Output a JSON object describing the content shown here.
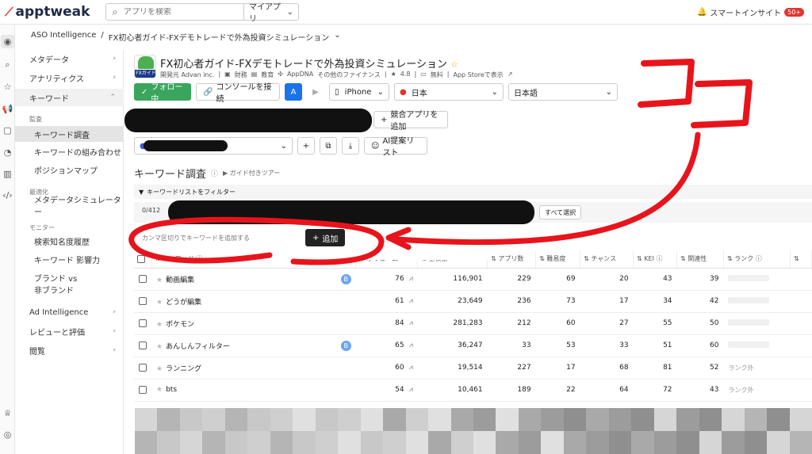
{
  "brand": {
    "name": "apptweak"
  },
  "topbar": {
    "search_placeholder": "アプリを検索",
    "my_apps_label": "マイアプリ",
    "insight_label": "スマートインサイト",
    "insight_badge": "50+"
  },
  "breadcrumb": {
    "root": "ASO Intelligence",
    "separator": "/",
    "current": "FX初心者ガイド-FXデモトレードで外為投資シミュレーション"
  },
  "sidebar": {
    "metadata": "メタデータ",
    "analytics": "アナリティクス",
    "keywords": "キーワード",
    "section_monitor": "監査",
    "keyword_research": "キーワード調査",
    "keyword_combinations": "キーワードの組み合わせ",
    "position_map": "ポジションマップ",
    "section_optimize": "最適化",
    "metadata_simulator": "メタデータシミュレーター",
    "section_monitoring": "モニター",
    "search_awareness_history": "検索知名度履歴",
    "keyword_impact": "キーワード 影響力",
    "brand_vs": "ブランド vs",
    "non_brand": "非ブランド",
    "ad_intelligence": "Ad Intelligence",
    "reviews": "レビューと評価",
    "browse": "閲覧"
  },
  "app": {
    "icon_label": "FXガイド",
    "title": "FX初心者ガイド-FXデモトレードで外為投資シミュレーション",
    "developer": "開発元 Advan inc.",
    "category1": "財務",
    "category2": "教育",
    "appdna": "AppDNA",
    "appdna_value": "その他のファイナンス",
    "rating": "4.8",
    "price": "無料",
    "store_link": "App Storeで表示"
  },
  "toolbar": {
    "follow": "フォロー中",
    "console": "コンソールを接続",
    "device": "iPhone",
    "country": "日本",
    "language": "日本語"
  },
  "competitors": {
    "add_label": "競合アプリを追加"
  },
  "list_bar": {
    "ai_suggest": "AI提案リスト"
  },
  "section": {
    "title": "キーワード調査",
    "guide": "ガイド付きツアー"
  },
  "filter": {
    "label": "キーワードリストをフィルター",
    "count": "0/412",
    "select_all": "すべて選択"
  },
  "add_keyword": {
    "placeholder": "カンマ区切りでキーワードを追加する",
    "button": "追加"
  },
  "table": {
    "headers": {
      "keyword": "キーワード",
      "volume": "ボリューム",
      "total_search": "全検索",
      "apps": "アプリ数",
      "difficulty": "難易度",
      "chance": "チャンス",
      "kei": "KEI",
      "relevance": "関連性",
      "rank": "ランク"
    },
    "rows": [
      {
        "keyword": "動画編集",
        "volume": "76",
        "total": "116,901",
        "apps": "229",
        "difficulty": "69",
        "chance": "20",
        "kei": "43",
        "relevance": "39",
        "rank": "",
        "brand": "B"
      },
      {
        "keyword": "どうが編集",
        "volume": "61",
        "total": "23,649",
        "apps": "236",
        "difficulty": "73",
        "chance": "17",
        "kei": "34",
        "relevance": "42",
        "rank": "",
        "brand": ""
      },
      {
        "keyword": "ポケモン",
        "volume": "84",
        "total": "281,283",
        "apps": "212",
        "difficulty": "60",
        "chance": "27",
        "kei": "55",
        "relevance": "50",
        "rank": "",
        "brand": ""
      },
      {
        "keyword": "あんしんフィルター",
        "volume": "65",
        "total": "36,247",
        "apps": "33",
        "difficulty": "53",
        "chance": "33",
        "kei": "51",
        "relevance": "60",
        "rank": "",
        "brand": "B"
      },
      {
        "keyword": "ランニング",
        "volume": "60",
        "total": "19,514",
        "apps": "227",
        "difficulty": "17",
        "chance": "68",
        "kei": "81",
        "relevance": "52",
        "rank": "ランク外",
        "brand": ""
      },
      {
        "keyword": "bts",
        "volume": "54",
        "total": "10,461",
        "apps": "189",
        "difficulty": "22",
        "chance": "64",
        "kei": "72",
        "relevance": "43",
        "rank": "ランク外",
        "brand": ""
      }
    ]
  },
  "annotation": {
    "text": "ココ",
    "color": "#e8141b"
  }
}
